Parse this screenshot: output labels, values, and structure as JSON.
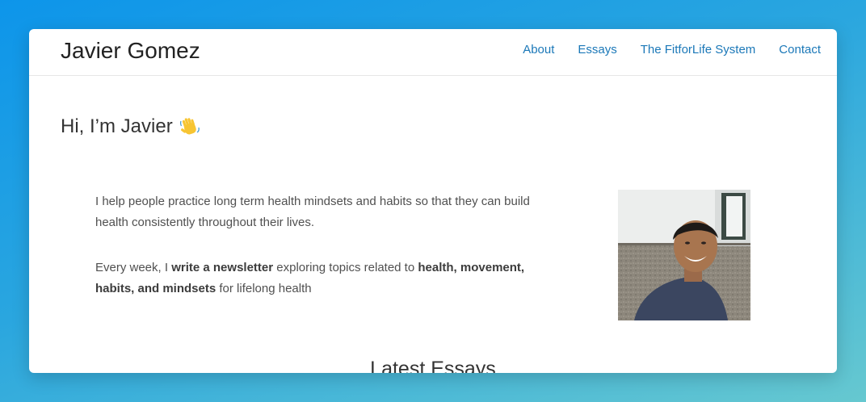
{
  "site": {
    "title": "Javier Gomez"
  },
  "nav": [
    {
      "label": "About"
    },
    {
      "label": "Essays"
    },
    {
      "label": "The FitforLife System"
    },
    {
      "label": "Contact"
    }
  ],
  "hero": {
    "greeting": "Hi, I’m Javier",
    "emoji_icon": "waving-hand-icon",
    "paragraph1": "I help people practice long term health mindsets and habits so that they can build health consistently throughout their lives.",
    "paragraph2": {
      "part1": "Every week, I ",
      "bold1": "write a newsletter",
      "part2": " exploring topics related to ",
      "bold2": "health, movement, habits, and mindsets",
      "part3": " for lifelong health"
    }
  },
  "latest_essays": {
    "title": "Latest Essays"
  },
  "colors": {
    "link": "#1b78b8",
    "text": "#505050",
    "heading": "#333333",
    "background_gradient_start": "#0d95ea",
    "background_gradient_end": "#66c8d0"
  }
}
